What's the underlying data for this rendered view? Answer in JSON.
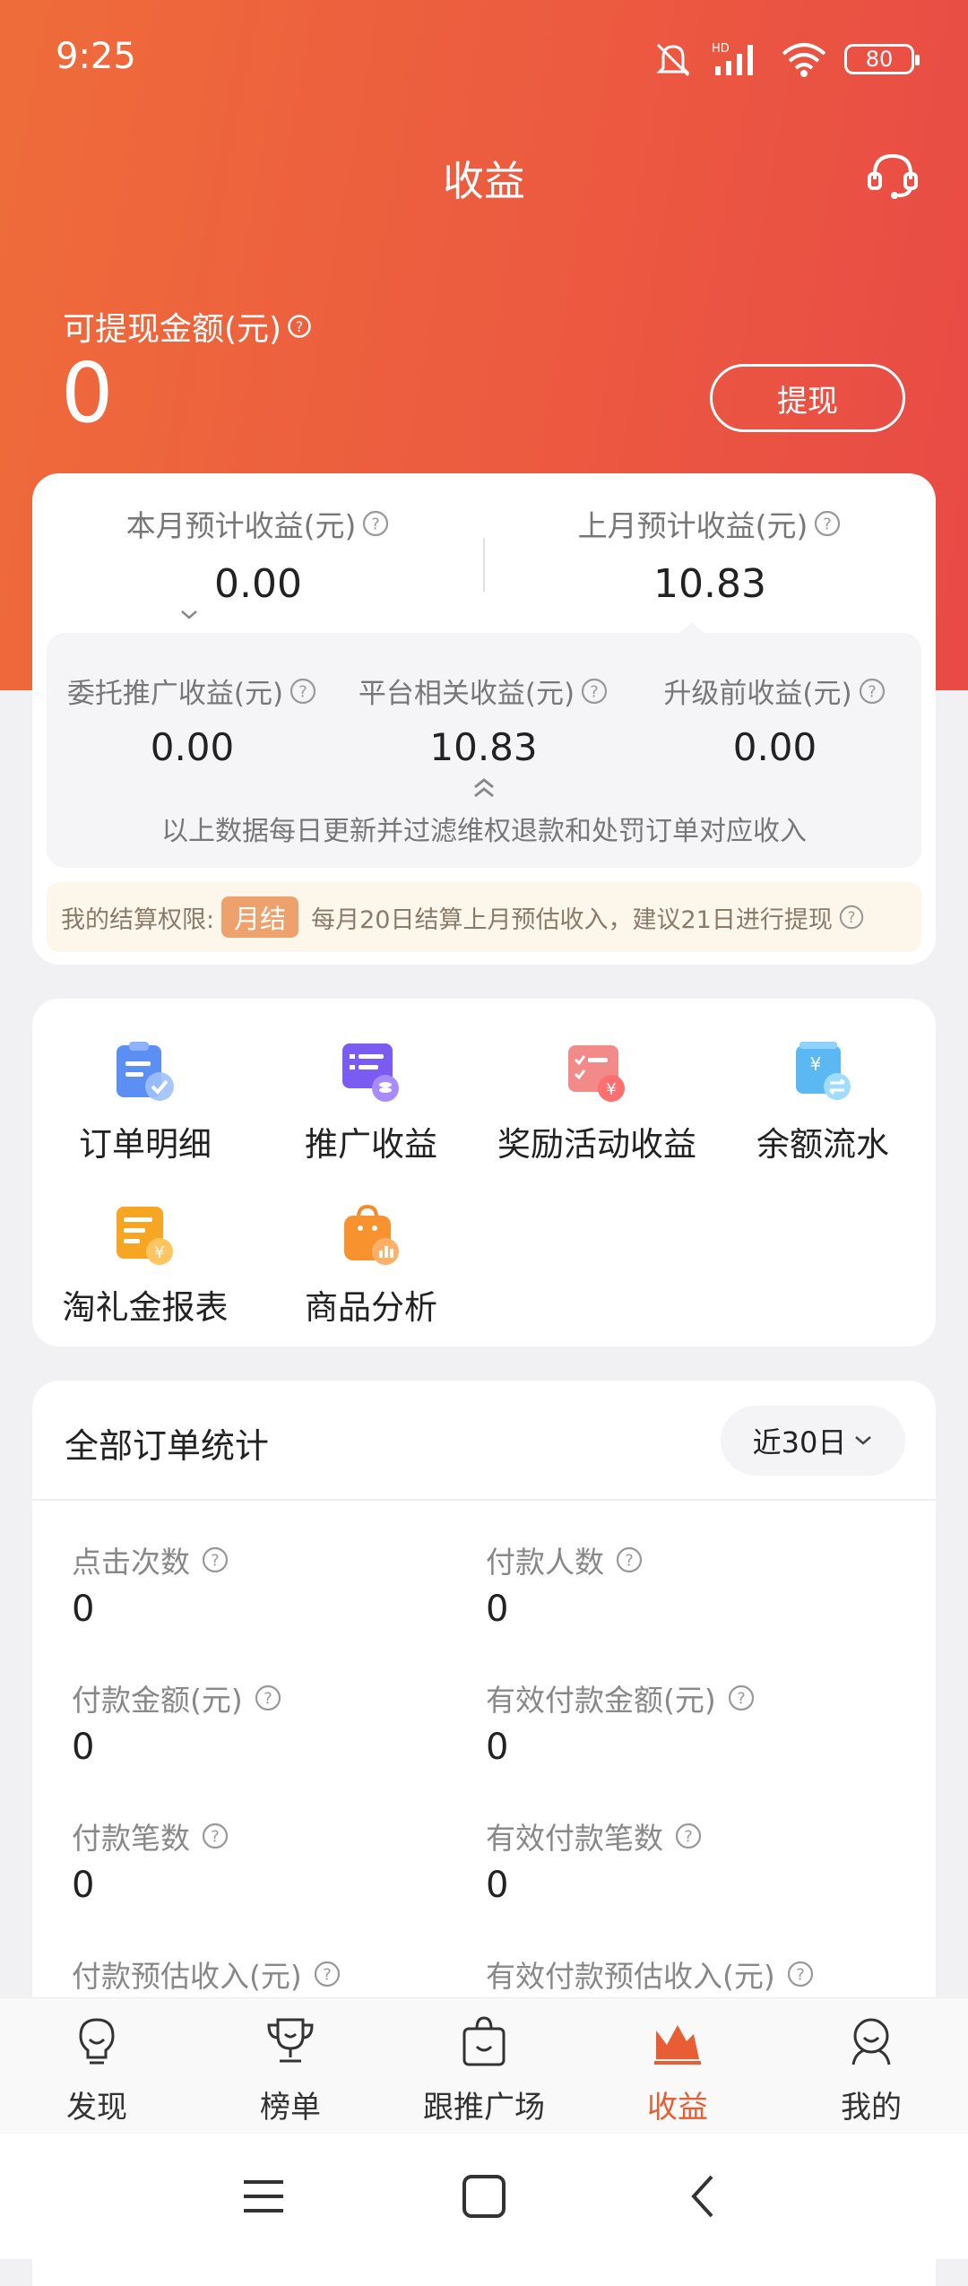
{
  "status_bar": {
    "time": "9:25",
    "battery": "80",
    "network": "HD"
  },
  "header": {
    "title": "收益",
    "service_icon": "headset-icon"
  },
  "withdraw": {
    "label": "可提现金额(元)",
    "amount": "0",
    "button": "提现"
  },
  "earnings": {
    "this_month": {
      "label": "本月预计收益(元)",
      "value": "0.00"
    },
    "last_month": {
      "label": "上月预计收益(元)",
      "value": "10.83"
    },
    "breakdown": [
      {
        "label": "委托推广收益(元)",
        "value": "0.00"
      },
      {
        "label": "平台相关收益(元)",
        "value": "10.83"
      },
      {
        "label": "升级前收益(元)",
        "value": "0.00"
      }
    ],
    "note": "以上数据每日更新并过滤维权退款和处罚订单对应收入",
    "settlement": {
      "label": "我的结算权限:",
      "tag": "月结",
      "desc": "每月20日结算上月预估收入，建议21日进行提现"
    }
  },
  "tools": [
    {
      "label": "订单明细",
      "icon": "order-detail-icon"
    },
    {
      "label": "推广收益",
      "icon": "promo-earning-icon"
    },
    {
      "label": "奖励活动收益",
      "icon": "reward-activity-icon"
    },
    {
      "label": "余额流水",
      "icon": "balance-flow-icon"
    },
    {
      "label": "淘礼金报表",
      "icon": "gift-report-icon"
    },
    {
      "label": "商品分析",
      "icon": "product-analysis-icon"
    }
  ],
  "stats": {
    "title": "全部订单统计",
    "range": "近30日",
    "items": [
      {
        "label": "点击次数",
        "value": "0"
      },
      {
        "label": "付款人数",
        "value": "0"
      },
      {
        "label": "付款金额(元)",
        "value": "0"
      },
      {
        "label": "有效付款金额(元)",
        "value": "0"
      },
      {
        "label": "付款笔数",
        "value": "0"
      },
      {
        "label": "有效付款笔数",
        "value": "0"
      },
      {
        "label": "付款预估收入(元)",
        "value": ""
      },
      {
        "label": "有效付款预估收入(元)",
        "value": ""
      }
    ]
  },
  "tabbar": [
    {
      "label": "发现",
      "icon": "discover-icon",
      "active": false
    },
    {
      "label": "榜单",
      "icon": "trophy-icon",
      "active": false
    },
    {
      "label": "跟推广场",
      "icon": "shopping-bag-icon",
      "active": false
    },
    {
      "label": "收益",
      "icon": "earnings-chart-icon",
      "active": true
    },
    {
      "label": "我的",
      "icon": "profile-icon",
      "active": false
    }
  ],
  "colors": {
    "brand_start": "#ee6c3a",
    "brand_end": "#e84a45",
    "active_tab": "#e85d33",
    "settle_tag": "#eda26d"
  }
}
